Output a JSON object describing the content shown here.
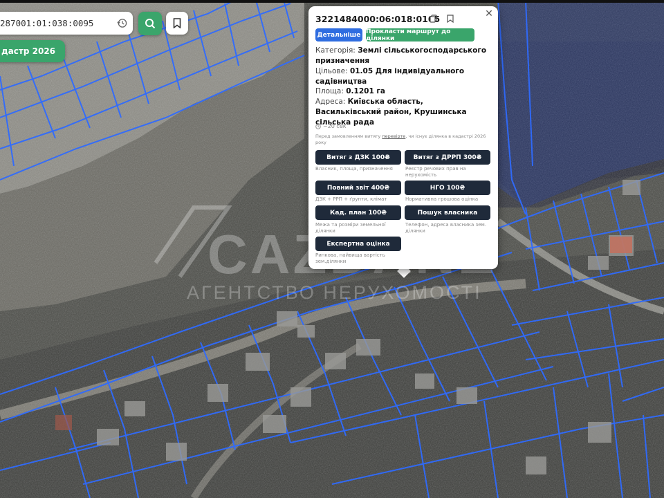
{
  "search": {
    "value": "287001:01:038:0095"
  },
  "kadastr_chip": "дастр 2026",
  "watermark": {
    "brand": "CAZDANE",
    "tagline": "АГЕНТСТВО НЕРУХОМОСТІ"
  },
  "popup": {
    "cadastral_number": "3221484000:06:018:0105",
    "btn_details": "Детальніше",
    "btn_route": "Прокласти маршрут до ділянки",
    "category_label": "Категорія:",
    "category_value": "Землі сільськогосподарського призначення",
    "purpose_label": "Цільове:",
    "purpose_value": "01.05 Для індивідуального садівництва",
    "area_label": "Площа:",
    "area_value": "0.1201 га",
    "address_label": "Адреса:",
    "address_value": "Київська область, Васильківський район, Крушинська сільська рада",
    "timer": "~20 сек",
    "note_before": "Перед замовленням витягу",
    "note_link": "перевірте",
    "note_after": ", чи існує ділянка в кадастрі 2026 року",
    "orders": [
      {
        "label": "Витяг з ДЗК 100₴",
        "desc": "Власник, площа, призначення"
      },
      {
        "label": "Витяг з ДРРП 300₴",
        "desc": "Реєстр речових прав на нерухомість"
      },
      {
        "label": "Повний звіт 400₴",
        "desc": "ДЗК + РРП + ґрунти, клімат"
      },
      {
        "label": "НГО 100₴",
        "desc": "Нормативна грошова оцінка"
      },
      {
        "label": "Кад. план 100₴",
        "desc": "Межа та розміри земельної ділянки"
      },
      {
        "label": "Пошук власника",
        "desc": "Телефон, адреса власника зем. ділянки"
      },
      {
        "label": "Експертна оцінка",
        "desc": "Ринкова, найвища вартість зем.ділянки"
      }
    ]
  },
  "colors": {
    "green": "#3aa56b",
    "blue": "#2f6de0",
    "dark_button": "#1f2a3a",
    "parcel_line": "#2f6bff"
  }
}
